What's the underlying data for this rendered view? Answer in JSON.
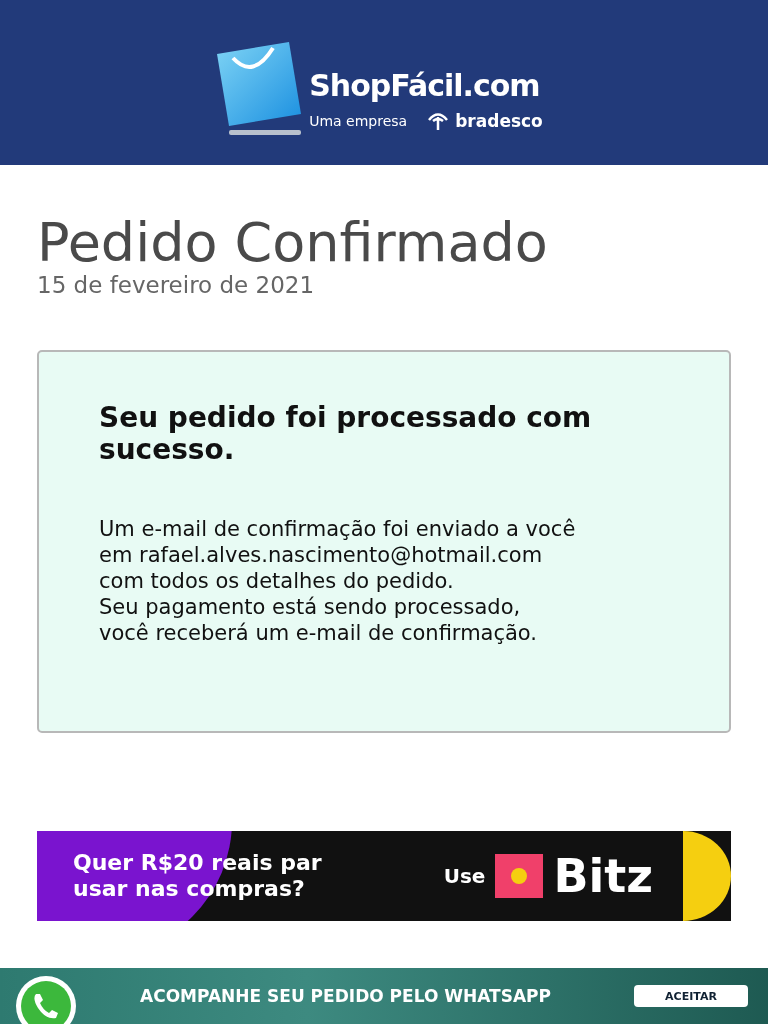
{
  "header": {
    "brand": "ShopFácil.com",
    "tagline": "Uma empresa",
    "partner": "bradesco"
  },
  "title": "Pedido Confirmado",
  "date": "15 de fevereiro de 2021",
  "confirmation": {
    "heading": "Seu pedido foi processado com sucesso.",
    "lines": [
      "Um e-mail de confirmação foi enviado a você",
      "em rafael.alves.nascimento@hotmail.com",
      "com todos os detalhes do pedido.",
      "Seu pagamento está sendo processado,",
      "você receberá um e-mail de confirmação."
    ]
  },
  "ad": {
    "lines": [
      "Quer R$20 reais par",
      "usar nas compras?"
    ],
    "use": "Use",
    "brand": "Bitz"
  },
  "whatsapp_bar": {
    "text": "ACOMPANHE SEU PEDIDO PELO WHATSAPP",
    "button": "ACEITAR"
  }
}
